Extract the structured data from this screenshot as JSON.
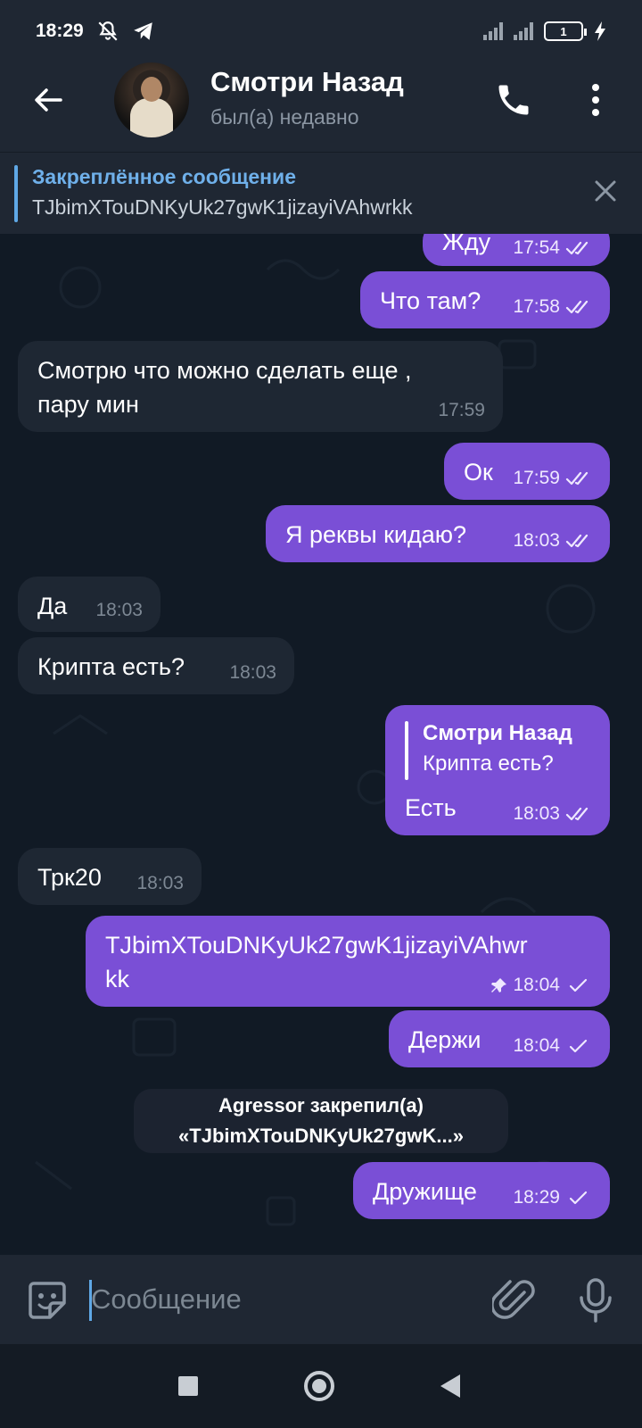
{
  "status_bar": {
    "time": "18:29",
    "battery": "1"
  },
  "header": {
    "contact_name": "Смотри Назад",
    "contact_status": "был(а) недавно"
  },
  "pinned": {
    "title": "Закреплённое сообщение",
    "text": "TJbimXTouDNKyUk27gwK1jizayiVAhwrkk"
  },
  "messages": [
    {
      "dir": "out",
      "text": "Жду",
      "time": "17:54",
      "status": "read"
    },
    {
      "dir": "out",
      "text": "Что там?",
      "time": "17:58",
      "status": "read"
    },
    {
      "dir": "in",
      "text_line1": "Смотрю что можно сделать еще ,",
      "text_line2": "пару мин",
      "time": "17:59"
    },
    {
      "dir": "out",
      "text": "Ок",
      "time": "17:59",
      "status": "read"
    },
    {
      "dir": "out",
      "text": "Я реквы кидаю?",
      "time": "18:03",
      "status": "read"
    },
    {
      "dir": "in",
      "text": "Да",
      "time": "18:03"
    },
    {
      "dir": "in",
      "text": "Крипта есть?",
      "time": "18:03"
    },
    {
      "dir": "out",
      "reply_name": "Смотри Назад",
      "reply_text": "Крипта есть?",
      "text": "Есть",
      "time": "18:03",
      "status": "read"
    },
    {
      "dir": "in",
      "text": "Трк20",
      "time": "18:03"
    },
    {
      "dir": "out",
      "text_line1": "TJbimXTouDNKyUk27gwK1jizayiVAhwr",
      "text_line2": "kk",
      "time": "18:04",
      "status": "sent",
      "pinned": true
    },
    {
      "dir": "out",
      "text": "Держи",
      "time": "18:04",
      "status": "sent"
    },
    {
      "dir": "out",
      "text": "Дружище",
      "time": "18:29",
      "status": "sent"
    }
  ],
  "service_message": {
    "line1": "Agressor закрепил(а)",
    "line2": "«TJbimXTouDNKyUk27gwK...»"
  },
  "input": {
    "placeholder": "Сообщение"
  },
  "colors": {
    "outgoing_bubble": "#7a4fd6",
    "incoming_bubble": "#1e2733",
    "accent": "#5fa8e6"
  }
}
